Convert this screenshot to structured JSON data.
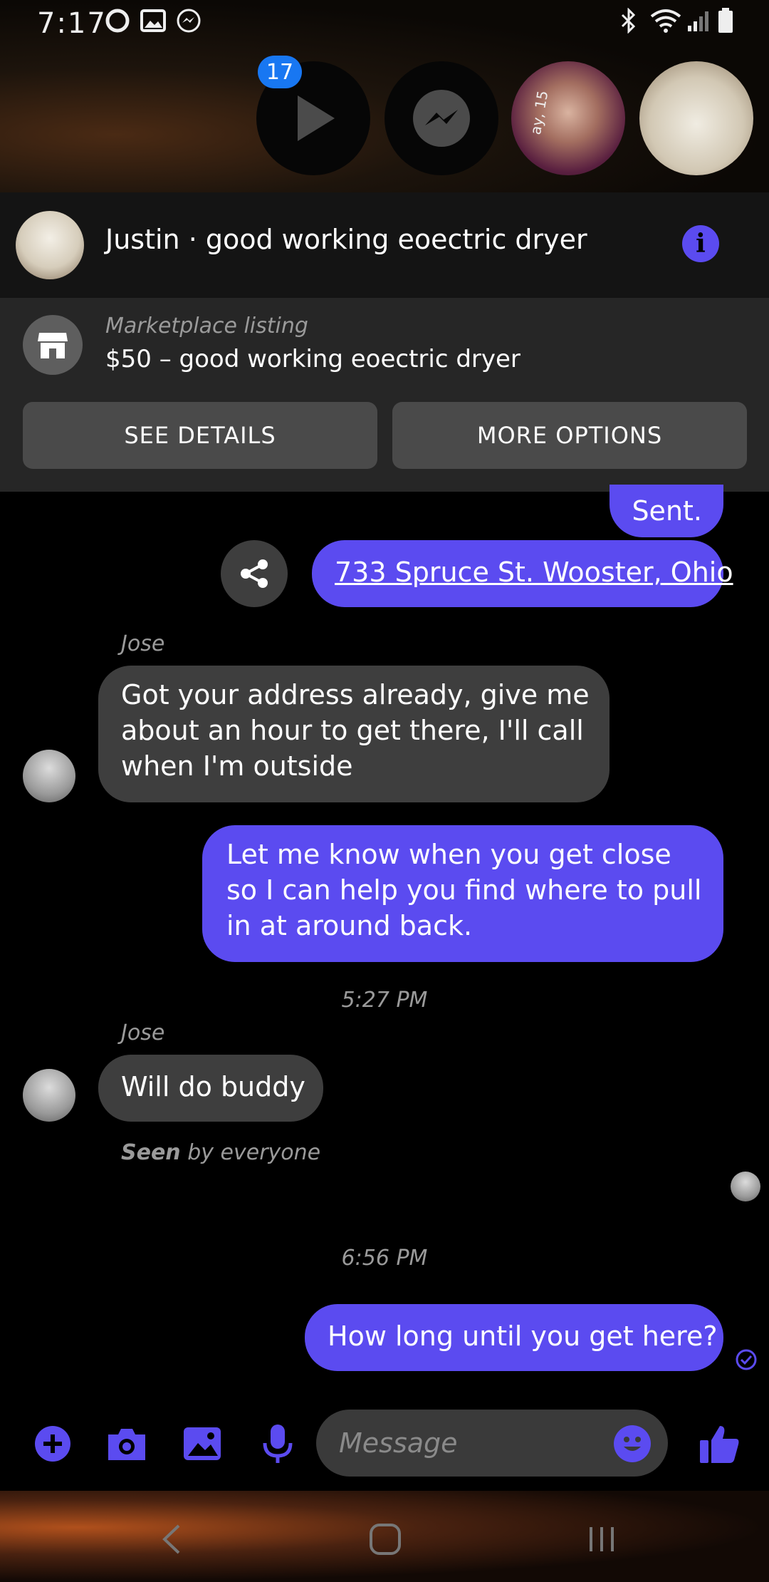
{
  "status_bar": {
    "time": "7:17"
  },
  "chat_heads": {
    "badge_count": "17",
    "story_text": "ay, 15"
  },
  "header": {
    "title": "Justin · good working eoectric dryer"
  },
  "marketplace": {
    "label": "Marketplace listing",
    "price_title": "$50 – good working eoectric dryer",
    "see_details": "SEE DETAILS",
    "more_options": "MORE OPTIONS"
  },
  "messages": {
    "sent_partial": "Sent.",
    "address": "733 Spruce St. Wooster, Ohio",
    "sender_1": "Jose",
    "msg_jose_1": "Got your address already, give me about an hour to get there, I'll call when I'm outside",
    "msg_me_1": "Let me know when you get close so I can help you find where to pull in at around back.",
    "time_1": "5:27 PM",
    "sender_2": "Jose",
    "msg_jose_2": "Will do buddy",
    "seen_bold": "Seen",
    "seen_rest": " by everyone",
    "time_2": "6:56 PM",
    "msg_me_2": "How long until you get here?"
  },
  "composer": {
    "placeholder": "Message"
  },
  "colors": {
    "accent": "#5b4bf0",
    "incoming": "#3e3e3e",
    "badge": "#1877f2"
  }
}
